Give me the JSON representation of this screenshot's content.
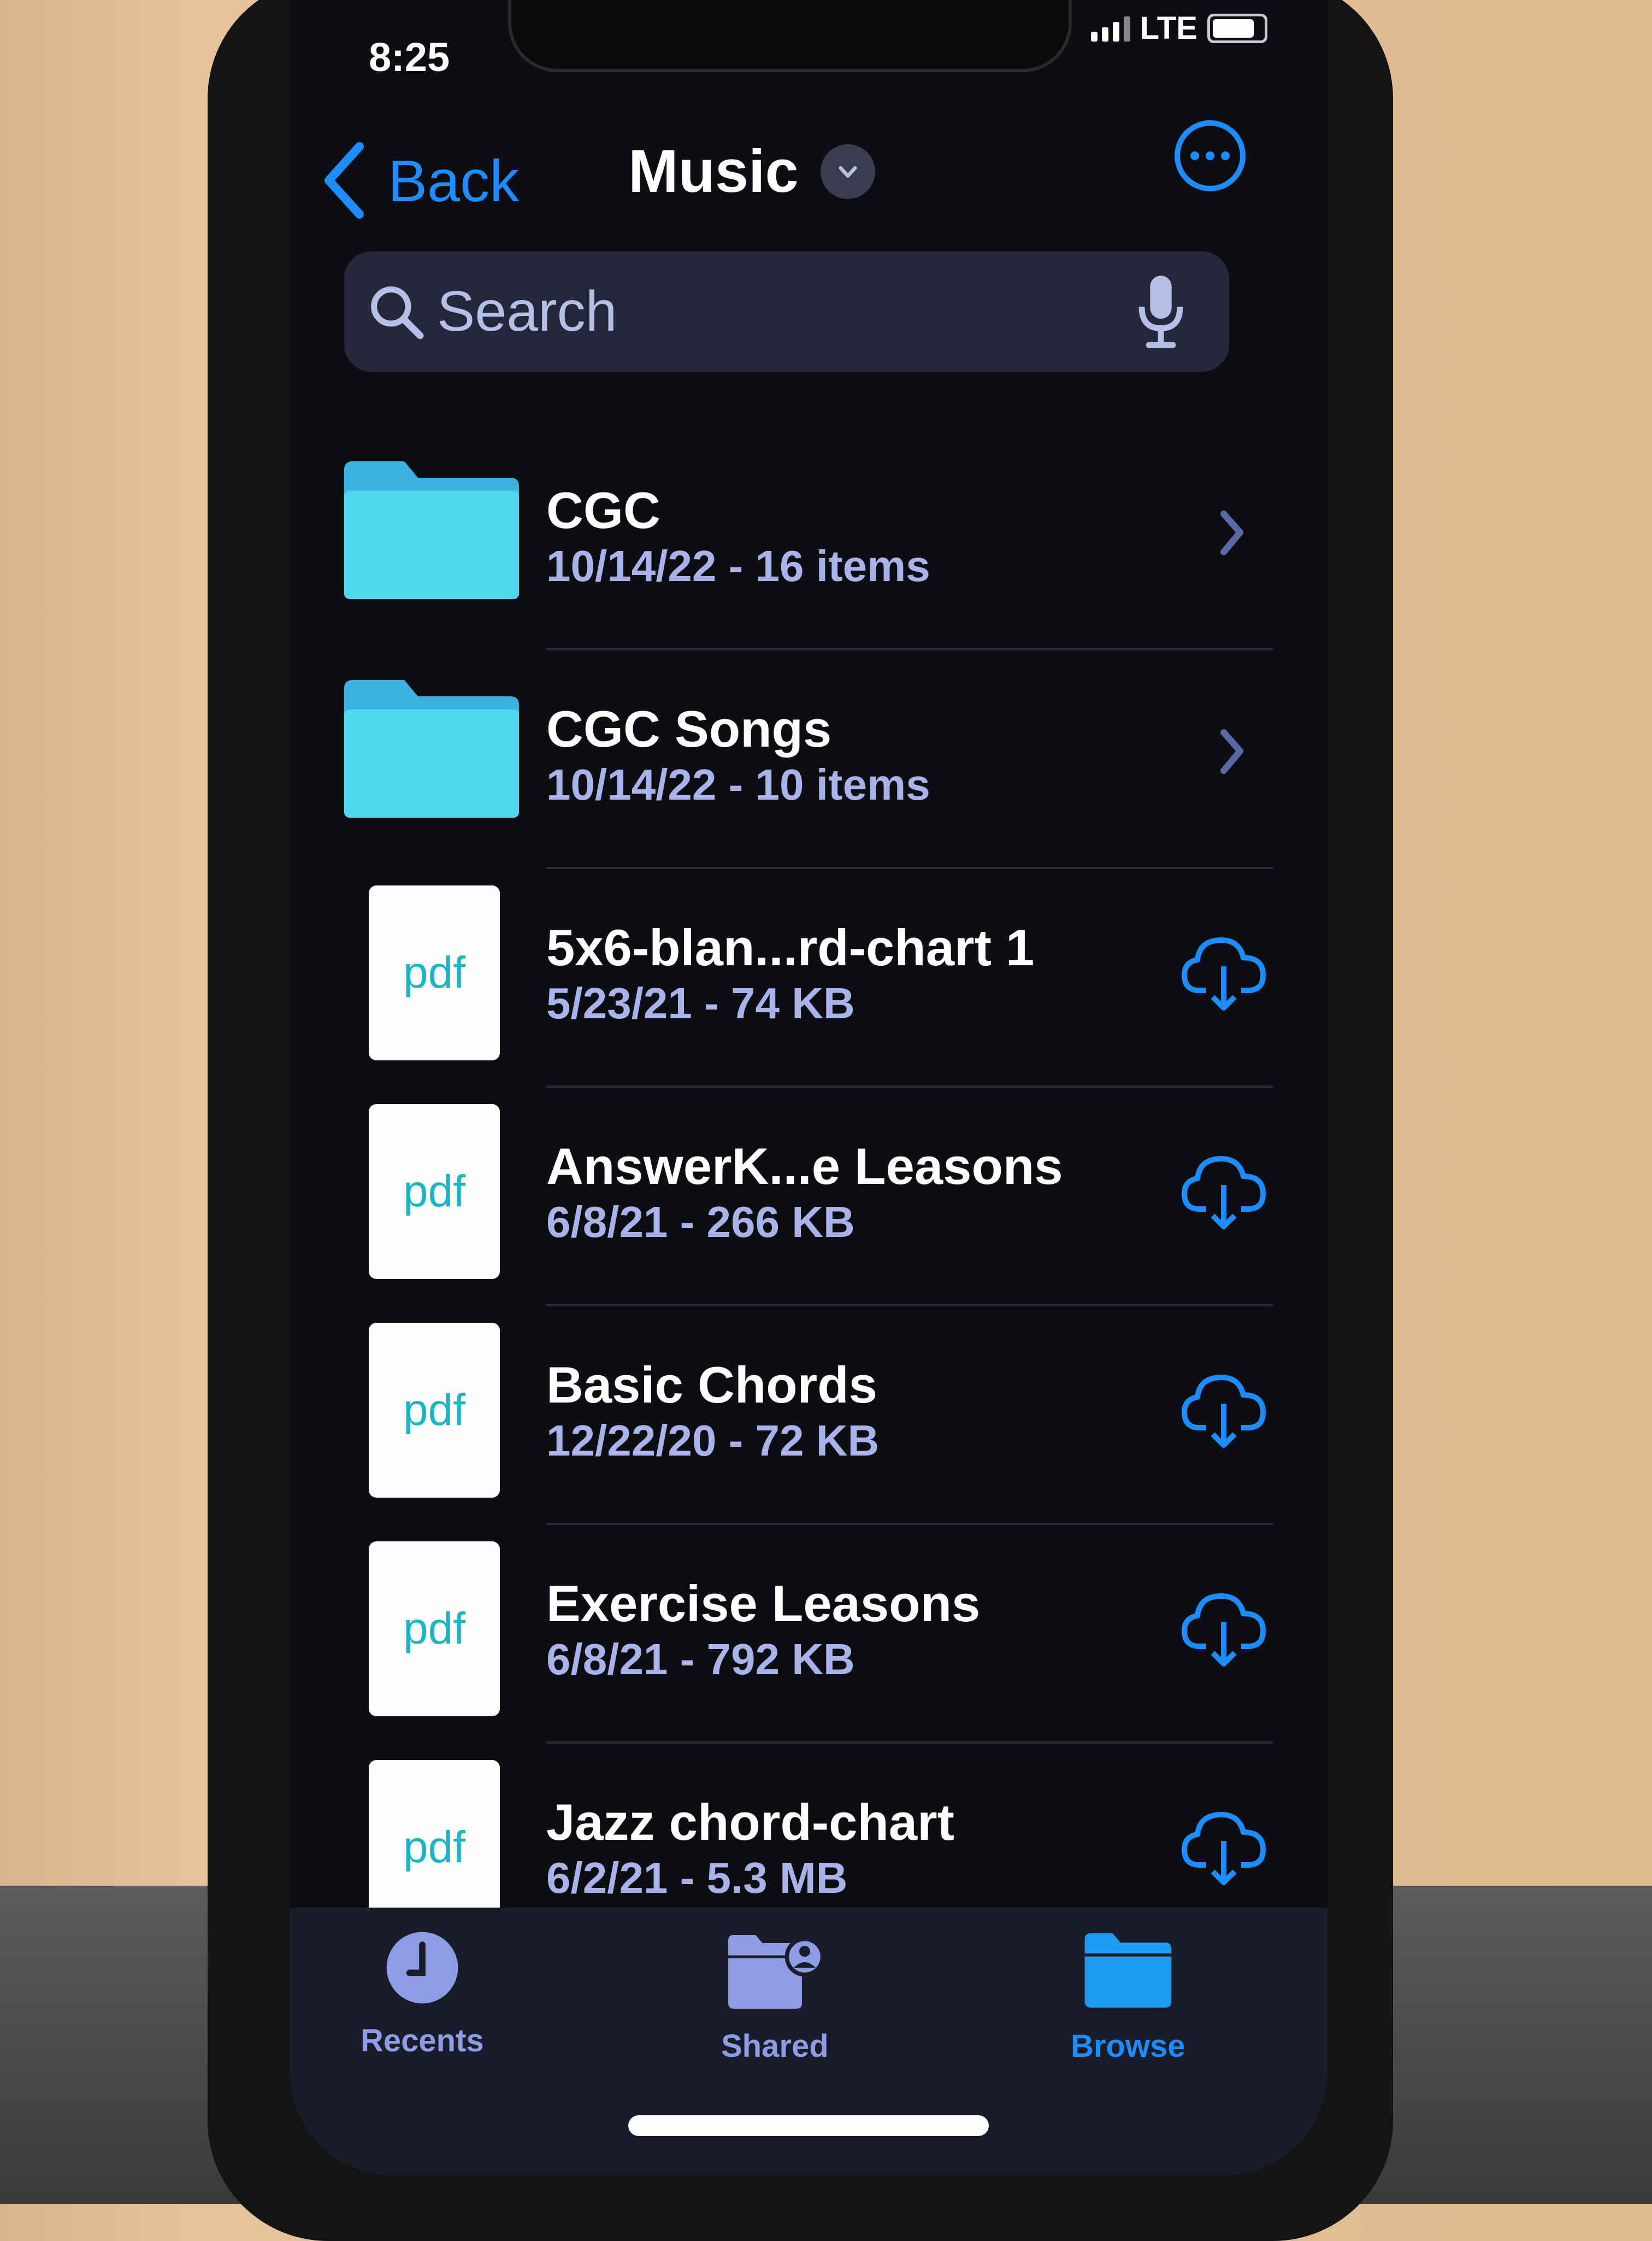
{
  "status_bar": {
    "time": "8:25",
    "network": "LTE"
  },
  "nav": {
    "back_label": "Back",
    "title": "Music"
  },
  "search": {
    "placeholder": "Search"
  },
  "items": [
    {
      "type": "folder",
      "name": "CGC",
      "meta": "10/14/22 - 16 items",
      "action": "chevron-right-icon"
    },
    {
      "type": "folder",
      "name": "CGC Songs",
      "meta": "10/14/22 - 10 items",
      "action": "chevron-right-icon"
    },
    {
      "type": "pdf",
      "icon_label": "pdf",
      "name": "5x6-blan...rd-chart 1",
      "meta": "5/23/21 - 74 KB",
      "action": "cloud-download-icon"
    },
    {
      "type": "pdf",
      "icon_label": "pdf",
      "name": "AnswerK...e Leasons",
      "meta": "6/8/21 - 266 KB",
      "action": "cloud-download-icon"
    },
    {
      "type": "pdf",
      "icon_label": "pdf",
      "name": "Basic Chords",
      "meta": "12/22/20 - 72 KB",
      "action": "cloud-download-icon"
    },
    {
      "type": "pdf",
      "icon_label": "pdf",
      "name": "Exercise Leasons",
      "meta": "6/8/21 - 792 KB",
      "action": "cloud-download-icon"
    },
    {
      "type": "pdf",
      "icon_label": "pdf",
      "name": "Jazz chord-chart",
      "meta": "6/2/21 - 5.3 MB",
      "action": "cloud-download-icon"
    }
  ],
  "tabbar": {
    "tabs": [
      {
        "label": "Recents",
        "icon": "clock-icon",
        "active": false
      },
      {
        "label": "Shared",
        "icon": "shared-folder-icon",
        "active": false
      },
      {
        "label": "Browse",
        "icon": "folder-icon",
        "active": true
      }
    ]
  },
  "colors": {
    "accent": "#1d8cff",
    "folder": "#4fd8ec",
    "inactive_tab": "#8e9ce6",
    "meta_text": "#a8b3ec",
    "pdf_text": "#1bb5c4"
  }
}
